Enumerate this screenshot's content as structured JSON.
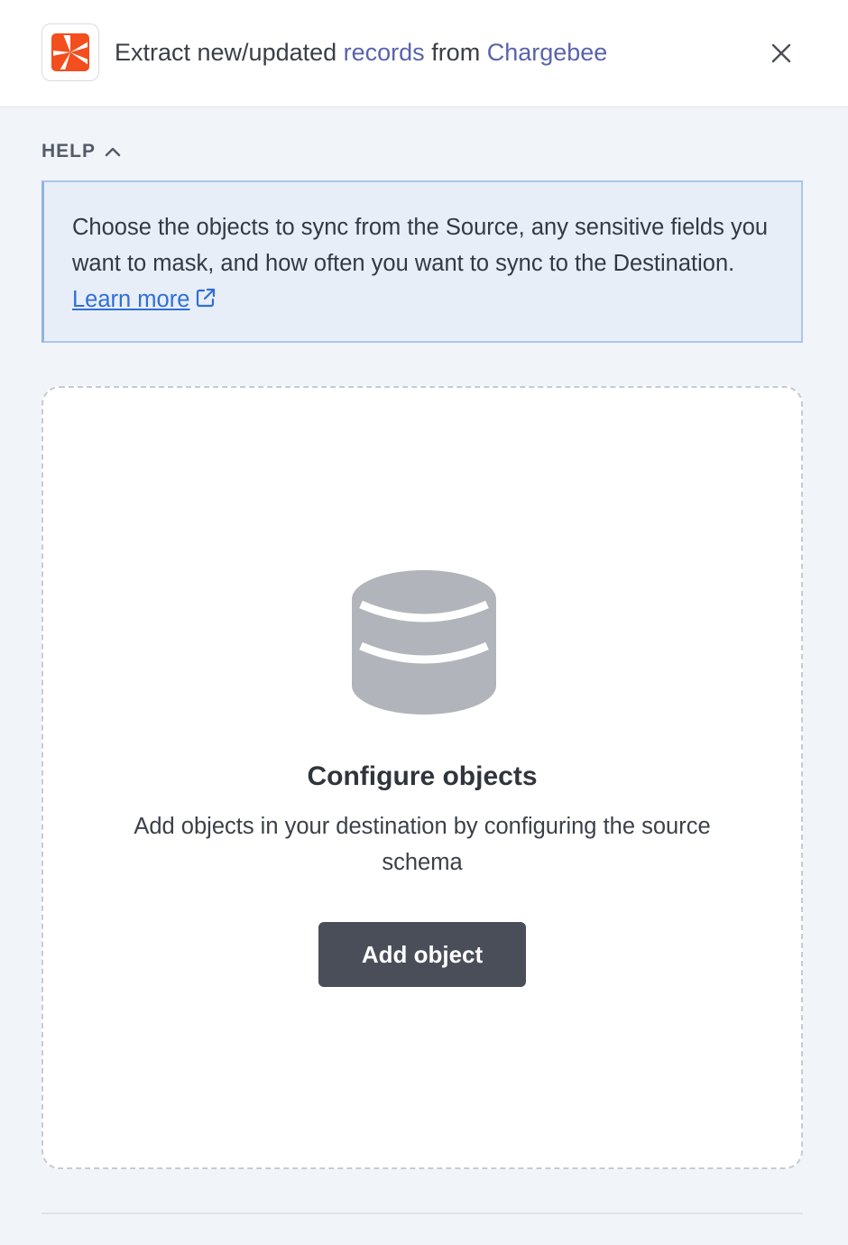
{
  "header": {
    "title_prefix": "Extract new/updated ",
    "title_object": "records",
    "title_middle": " from ",
    "title_source": "Chargebee",
    "logo_icon": "chargebee-logo-icon",
    "close_icon": "close-icon"
  },
  "help": {
    "toggle_label": "HELP",
    "toggle_icon": "chevron-up-icon",
    "text": "Choose the objects to sync from the Source, any sensitive fields you want to mask, and how often you want to sync to the Destination.",
    "link_label": "Learn more",
    "link_icon": "external-link-icon"
  },
  "empty_state": {
    "icon": "database-icon",
    "title": "Configure objects",
    "description": "Add objects in your destination by configuring the source schema",
    "button_label": "Add object"
  },
  "colors": {
    "accent": "#5a63ad",
    "link": "#2f6fd6",
    "logo_orange": "#f24e1e",
    "button_bg": "#4a4e58",
    "help_bg": "#e8eef7",
    "help_border": "#a9c6ec"
  }
}
